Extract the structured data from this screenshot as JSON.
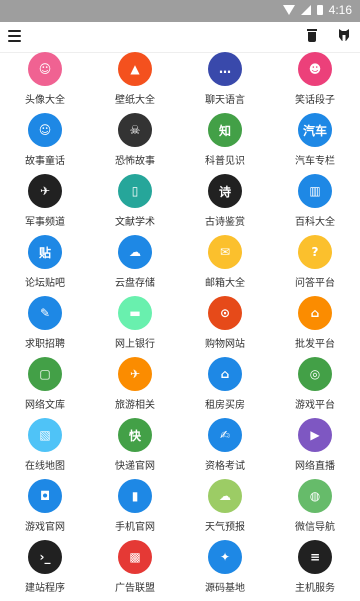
{
  "status_bar": {
    "time": "4:16"
  },
  "app_bar": {
    "menu_icon": "hamburger-menu-icon",
    "actions": [
      "trash-icon",
      "github-icon"
    ]
  },
  "grid": {
    "items": [
      {
        "label": "头像大全",
        "glyph": "☺",
        "color": "#f06292",
        "icon": "avatar-icon"
      },
      {
        "label": "壁纸大全",
        "glyph": "▲",
        "color": "#f4511e",
        "icon": "wallpaper-icon"
      },
      {
        "label": "聊天语言",
        "glyph": "…",
        "color": "#3949ab",
        "icon": "chat-icon"
      },
      {
        "label": "笑话段子",
        "glyph": "☻",
        "color": "#ec407a",
        "icon": "jokes-icon"
      },
      {
        "label": "故事童话",
        "glyph": "☺",
        "color": "#1e88e5",
        "icon": "story-icon"
      },
      {
        "label": "恐怖故事",
        "glyph": "☠",
        "color": "#333333",
        "icon": "horror-icon"
      },
      {
        "label": "科普见识",
        "glyph": "知",
        "color": "#43a047",
        "icon": "science-icon"
      },
      {
        "label": "汽车专栏",
        "glyph": "汽车",
        "color": "#1e88e5",
        "icon": "car-icon"
      },
      {
        "label": "军事频道",
        "glyph": "✈",
        "color": "#212121",
        "icon": "military-icon"
      },
      {
        "label": "文献学术",
        "glyph": "▯",
        "color": "#26a69a",
        "icon": "literature-icon"
      },
      {
        "label": "古诗鉴赏",
        "glyph": "诗",
        "color": "#212121",
        "icon": "poetry-icon"
      },
      {
        "label": "百科大全",
        "glyph": "▥",
        "color": "#1e88e5",
        "icon": "encyclopedia-icon"
      },
      {
        "label": "论坛贴吧",
        "glyph": "贴",
        "color": "#1e88e5",
        "icon": "forum-icon"
      },
      {
        "label": "云盘存储",
        "glyph": "☁",
        "color": "#1e88e5",
        "icon": "cloud-disk-icon"
      },
      {
        "label": "邮箱大全",
        "glyph": "✉",
        "color": "#fbc02d",
        "icon": "mail-icon"
      },
      {
        "label": "问答平台",
        "glyph": "?",
        "color": "#fbc02d",
        "icon": "qa-icon"
      },
      {
        "label": "求职招聘",
        "glyph": "✎",
        "color": "#1e88e5",
        "icon": "jobs-icon"
      },
      {
        "label": "网上银行",
        "glyph": "▬",
        "color": "#69f0ae",
        "icon": "bank-icon"
      },
      {
        "label": "购物网站",
        "glyph": "⊙",
        "color": "#e64a19",
        "icon": "shopping-icon"
      },
      {
        "label": "批发平台",
        "glyph": "⌂",
        "color": "#fb8c00",
        "icon": "wholesale-icon"
      },
      {
        "label": "网络文库",
        "glyph": "▢",
        "color": "#43a047",
        "icon": "library-icon"
      },
      {
        "label": "旅游相关",
        "glyph": "✈",
        "color": "#fb8c00",
        "icon": "travel-icon"
      },
      {
        "label": "租房买房",
        "glyph": "⌂",
        "color": "#1e88e5",
        "icon": "house-icon"
      },
      {
        "label": "游戏平台",
        "glyph": "◎",
        "color": "#43a047",
        "icon": "game-icon"
      },
      {
        "label": "在线地图",
        "glyph": "▧",
        "color": "#4fc3f7",
        "icon": "map-icon"
      },
      {
        "label": "快递官网",
        "glyph": "快",
        "color": "#43a047",
        "icon": "express-icon"
      },
      {
        "label": "资格考试",
        "glyph": "✍",
        "color": "#1e88e5",
        "icon": "exam-icon"
      },
      {
        "label": "网络直播",
        "glyph": "▶",
        "color": "#7e57c2",
        "icon": "live-icon"
      },
      {
        "label": "游戏官网",
        "glyph": "◘",
        "color": "#1e88e5",
        "icon": "game-site-icon"
      },
      {
        "label": "手机官网",
        "glyph": "▮",
        "color": "#1e88e5",
        "icon": "phone-icon"
      },
      {
        "label": "天气预报",
        "glyph": "☁",
        "color": "#9ccc65",
        "icon": "weather-icon"
      },
      {
        "label": "微信导航",
        "glyph": "◍",
        "color": "#66bb6a",
        "icon": "wechat-icon"
      },
      {
        "label": "建站程序",
        "glyph": "›_",
        "color": "#212121",
        "icon": "terminal-icon"
      },
      {
        "label": "广告联盟",
        "glyph": "▩",
        "color": "#e53935",
        "icon": "ads-icon"
      },
      {
        "label": "源码基地",
        "glyph": "✦",
        "color": "#1e88e5",
        "icon": "android-icon"
      },
      {
        "label": "主机服务",
        "glyph": "≡",
        "color": "#212121",
        "icon": "server-icon"
      }
    ]
  }
}
